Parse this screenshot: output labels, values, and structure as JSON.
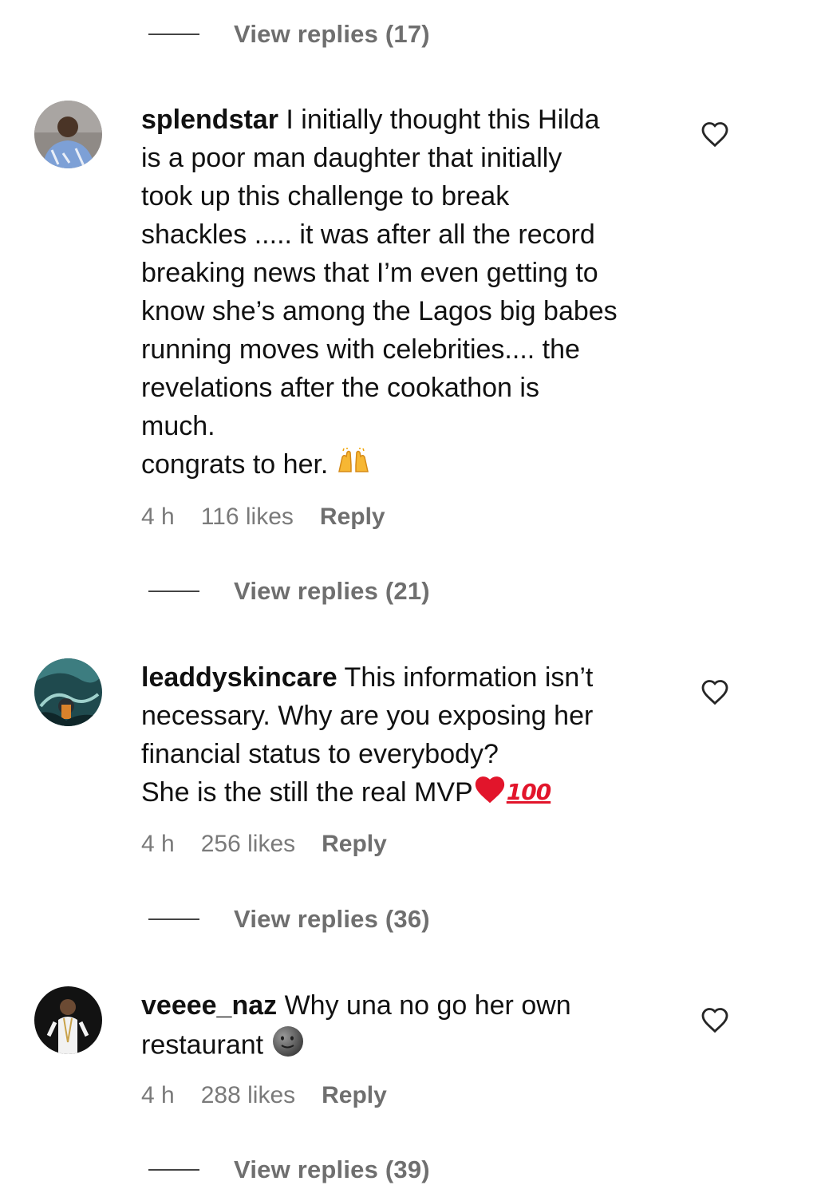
{
  "comments_thread": {
    "top_view_replies": "View replies (17)",
    "comments": [
      {
        "username": "splendstar",
        "text": "I initially thought this Hilda\nis a poor man daughter that initially\ntook up this challenge to break\nshackles ..... it was after all the record\nbreaking news that I’m even getting to\nknow she’s among the Lagos big babes\nrunning moves with celebrities.... the\nrevelations after the cookathon is\nmuch.\ncongrats to her.",
        "emoji": "raising-hands-emoji",
        "time": "4 h",
        "likes": "116 likes",
        "reply_label": "Reply",
        "view_replies": "View replies (21)"
      },
      {
        "username": "leaddyskincare",
        "text": "This information isn’t\nnecessary. Why are you exposing her\nfinancial status to everybody?\nShe is the still the real MVP",
        "emoji_heart": "red-heart-emoji",
        "emoji_hundred": "100",
        "time": "4 h",
        "likes": "256 likes",
        "reply_label": "Reply",
        "view_replies": "View replies (36)"
      },
      {
        "username": "veeee_naz",
        "text": "Why una no go her own\nrestaurant",
        "emoji": "new-moon-face-emoji",
        "time": "4 h",
        "likes": "288 likes",
        "reply_label": "Reply",
        "view_replies": "View replies (39)"
      }
    ]
  },
  "colors": {
    "text": "#111111",
    "meta": "#7a7a7a",
    "view_replies": "#6f6f6f",
    "divider": "#444444",
    "heart_stroke": "#262626",
    "emoji_red": "#e2152b"
  },
  "icons": {
    "like": "heart-outline-icon",
    "avatar": "user-avatar"
  }
}
